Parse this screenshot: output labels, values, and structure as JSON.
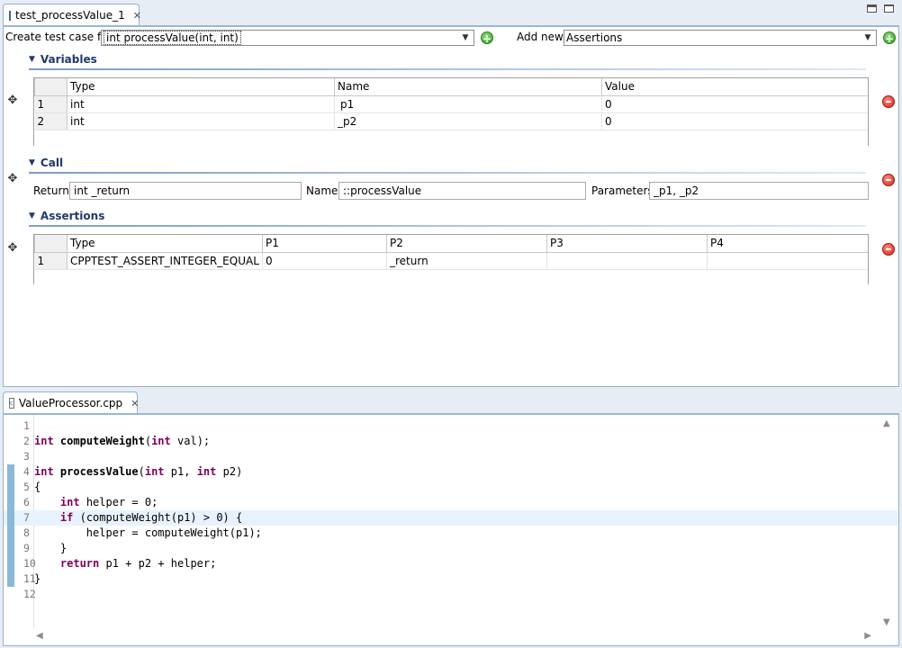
{
  "top_editor": {
    "tab_title": "test_processValue_1",
    "create_label": "Create test case for",
    "create_value": "int processValue(int, int)",
    "add_new_label": "Add new",
    "add_new_value": "Assertions",
    "variables": {
      "title": "Variables",
      "columns": [
        "Type",
        "Name",
        "Value"
      ],
      "rows": [
        {
          "num": "1",
          "type": "int",
          "name": "p1",
          "value": "0"
        },
        {
          "num": "2",
          "type": "int",
          "name": "_p2",
          "value": "0"
        }
      ]
    },
    "call": {
      "title": "Call",
      "return_label": "Return",
      "return_value": "int _return",
      "name_label": "Name",
      "name_value": "::processValue",
      "params_label": "Parameters",
      "params_value": "_p1, _p2"
    },
    "assertions": {
      "title": "Assertions",
      "columns": [
        "Type",
        "P1",
        "P2",
        "P3",
        "P4"
      ],
      "rows": [
        {
          "num": "1",
          "type": "CPPTEST_ASSERT_INTEGER_EQUAL",
          "p1": "0",
          "p2": "_return",
          "p3": "",
          "p4": ""
        }
      ]
    }
  },
  "code_editor": {
    "tab_title": "ValueProcessor.cpp",
    "lines": [
      {
        "n": "1",
        "text": ""
      },
      {
        "n": "2",
        "text": "int computeWeight(int val);"
      },
      {
        "n": "3",
        "text": ""
      },
      {
        "n": "4",
        "text": "int processValue(int p1, int p2)"
      },
      {
        "n": "5",
        "text": "{"
      },
      {
        "n": "6",
        "text": "    int helper = 0;"
      },
      {
        "n": "7",
        "text": "    if (computeWeight(p1) > 0) {"
      },
      {
        "n": "8",
        "text": "        helper = computeWeight(p1);"
      },
      {
        "n": "9",
        "text": "    }"
      },
      {
        "n": "10",
        "text": "    return p1 + p2 + helper;"
      },
      {
        "n": "11",
        "text": "}"
      },
      {
        "n": "12",
        "text": ""
      }
    ],
    "highlighted_line": "7",
    "covered_lines": [
      "4",
      "5",
      "6",
      "7",
      "8",
      "9",
      "10",
      "11"
    ]
  },
  "colors": {
    "keyword": "#7f0055",
    "coverage": "#8ab8d8",
    "highlight": "#e8f2fe"
  }
}
